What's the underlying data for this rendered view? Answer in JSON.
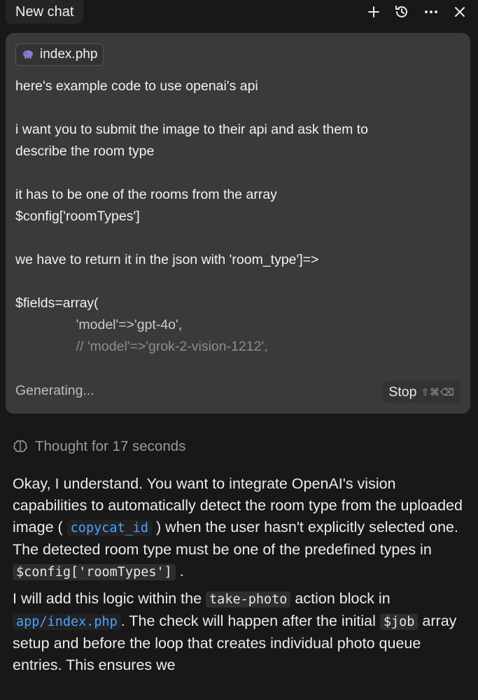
{
  "header": {
    "tab_title": "New chat",
    "icons": [
      "plus-icon",
      "history-icon",
      "more-icon",
      "close-icon"
    ]
  },
  "prompt": {
    "attachment": {
      "name": "index.php",
      "icon": "php-elephant-icon"
    },
    "lines": [
      "here's example code to use openai's api",
      "",
      "i want you to submit the image to their api and ask them to",
      "describe the room type",
      "",
      "it has to be one of the rooms from the array",
      "$config['roomTypes']",
      "",
      "we have to return it in the json with 'room_type']=>",
      "",
      "$fields=array(",
      "                'model'=>'gpt-4o',",
      "                // 'model'=>'grok-2-vision-1212',"
    ],
    "status": "Generating...",
    "stop_label": "Stop",
    "stop_shortcut": "⇧⌘⌫"
  },
  "thought": {
    "label": "Thought for 17 seconds",
    "icon": "brain-icon"
  },
  "response": {
    "p1": {
      "t1": "Okay, I understand. You want to integrate OpenAI's vision capabilities to automatically detect the room type from the uploaded image ( ",
      "code1": "copycat_id",
      "t2": " ) when the user hasn't explicitly selected one. The detected room type must be one of the predefined types in ",
      "code2": "$config['roomTypes']",
      "t3": " ."
    },
    "p2": {
      "t1": "I will add this logic within the ",
      "code1": "take-photo",
      "t2": " action block in ",
      "code2": "app/index.php",
      "t3": ". The check will happen after the initial ",
      "code3": "$job",
      "t4": " array setup and before the loop that creates individual photo queue entries. This ensures we"
    }
  },
  "colors": {
    "background": "#181818",
    "card": "#3a3a3a",
    "link_code": "#4ba3ff",
    "muted": "#9a9a9a"
  }
}
